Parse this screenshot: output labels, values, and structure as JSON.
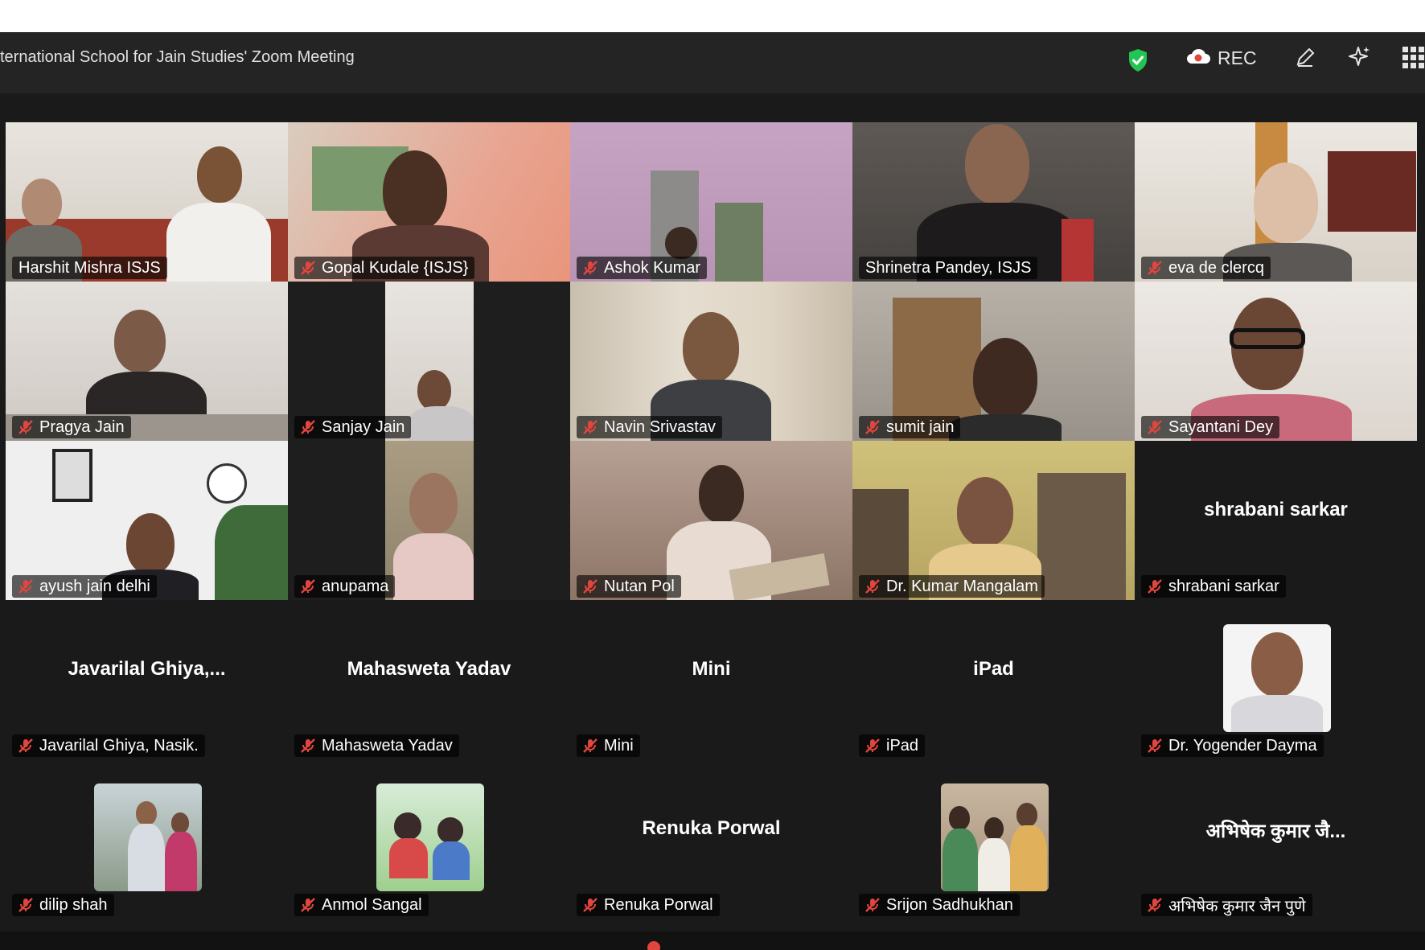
{
  "window": {
    "title": "ternational School for Jain Studies' Zoom Meeting"
  },
  "toolbar": {
    "rec_label": "REC",
    "shield_icon": "shield-check-icon",
    "rec_icon": "cloud-record-icon",
    "annotate_icon": "pen-icon",
    "ai_icon": "sparkle-icon",
    "view_icon": "grid-view-icon"
  },
  "colors": {
    "accent_active_speaker": "#23d96b",
    "mute_red": "#e0463e",
    "secure_green": "#23c552",
    "background": "#1a1a1a",
    "titlebar": "#242424"
  },
  "participants": [
    {
      "name": "Harshit Mishra ISJS",
      "muted": false,
      "video": true
    },
    {
      "name": "Gopal Kudale {ISJS}",
      "muted": true,
      "video": true
    },
    {
      "name": "Ashok Kumar",
      "muted": true,
      "video": true
    },
    {
      "name": "Shrinetra Pandey, ISJS",
      "muted": false,
      "video": true,
      "active_speaker": true
    },
    {
      "name": "eva de clercq",
      "muted": true,
      "video": true
    },
    {
      "name": "Pragya Jain",
      "muted": true,
      "video": true
    },
    {
      "name": "Sanjay Jain",
      "muted": true,
      "video": true
    },
    {
      "name": "Navin Srivastav",
      "muted": true,
      "video": true
    },
    {
      "name": "sumit jain",
      "muted": true,
      "video": true
    },
    {
      "name": "Sayantani Dey",
      "muted": true,
      "video": true
    },
    {
      "name": "ayush jain delhi",
      "muted": true,
      "video": true
    },
    {
      "name": "anupama",
      "muted": true,
      "video": true
    },
    {
      "name": "Nutan Pol",
      "muted": true,
      "video": true
    },
    {
      "name": "Dr. Kumar Mangalam",
      "muted": true,
      "video": true
    },
    {
      "name": "shrabani sarkar",
      "display_name": "shrabani sarkar",
      "muted": true,
      "video": false
    },
    {
      "name": "Javarilal Ghiya, Nasik.",
      "display_name": "Javarilal  Ghiya,...",
      "muted": true,
      "video": false
    },
    {
      "name": "Mahasweta Yadav",
      "display_name": "Mahasweta Yadav",
      "muted": true,
      "video": false
    },
    {
      "name": "Mini",
      "display_name": "Mini",
      "muted": true,
      "video": false
    },
    {
      "name": "iPad",
      "display_name": "iPad",
      "muted": true,
      "video": false
    },
    {
      "name": "Dr. Yogender Dayma",
      "muted": true,
      "video": false,
      "avatar": true
    },
    {
      "name": "dilip shah",
      "muted": true,
      "video": false,
      "avatar": true
    },
    {
      "name": "Anmol Sangal",
      "muted": true,
      "video": false,
      "avatar": true
    },
    {
      "name": "Renuka Porwal",
      "display_name": "Renuka Porwal",
      "muted": true,
      "video": false
    },
    {
      "name": "Srijon Sadhukhan",
      "muted": true,
      "video": false,
      "avatar": true
    },
    {
      "name": "अभिषेक कुमार जैन पुणे",
      "display_name": "अभिषेक कुमार जै...",
      "muted": true,
      "video": false
    }
  ]
}
